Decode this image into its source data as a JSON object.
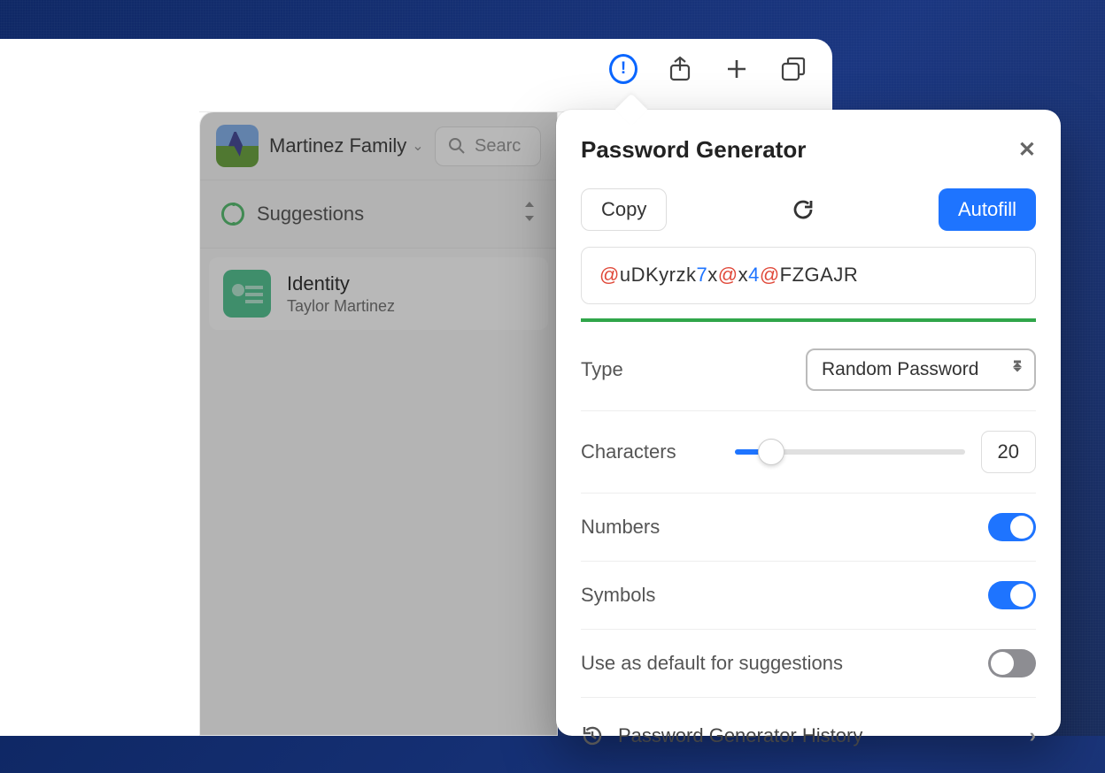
{
  "browser": {
    "icons": [
      "extension",
      "share",
      "new-tab",
      "tabs-overview"
    ]
  },
  "mini_panel": {
    "account_name": "Martinez Family",
    "search_placeholder": "Searc",
    "section_label": "Suggestions",
    "item": {
      "title": "Identity",
      "subtitle": "Taylor Martinez"
    }
  },
  "popup": {
    "title": "Password Generator",
    "copy_label": "Copy",
    "autofill_label": "Autofill",
    "password_segments": [
      {
        "t": "sym",
        "v": "@"
      },
      {
        "t": "ltr",
        "v": "uDKyrzk"
      },
      {
        "t": "num",
        "v": "7"
      },
      {
        "t": "ltr",
        "v": "x"
      },
      {
        "t": "sym",
        "v": "@"
      },
      {
        "t": "ltr",
        "v": "x"
      },
      {
        "t": "num",
        "v": "4"
      },
      {
        "t": "sym",
        "v": "@"
      },
      {
        "t": "ltr",
        "v": "FZGAJR"
      }
    ],
    "type_label": "Type",
    "type_value": "Random Password",
    "characters_label": "Characters",
    "characters_value": "20",
    "slider_percent": 16,
    "numbers_label": "Numbers",
    "numbers_on": true,
    "symbols_label": "Symbols",
    "symbols_on": true,
    "default_label": "Use as default for suggestions",
    "default_on": false,
    "history_label": "Password Generator History"
  }
}
